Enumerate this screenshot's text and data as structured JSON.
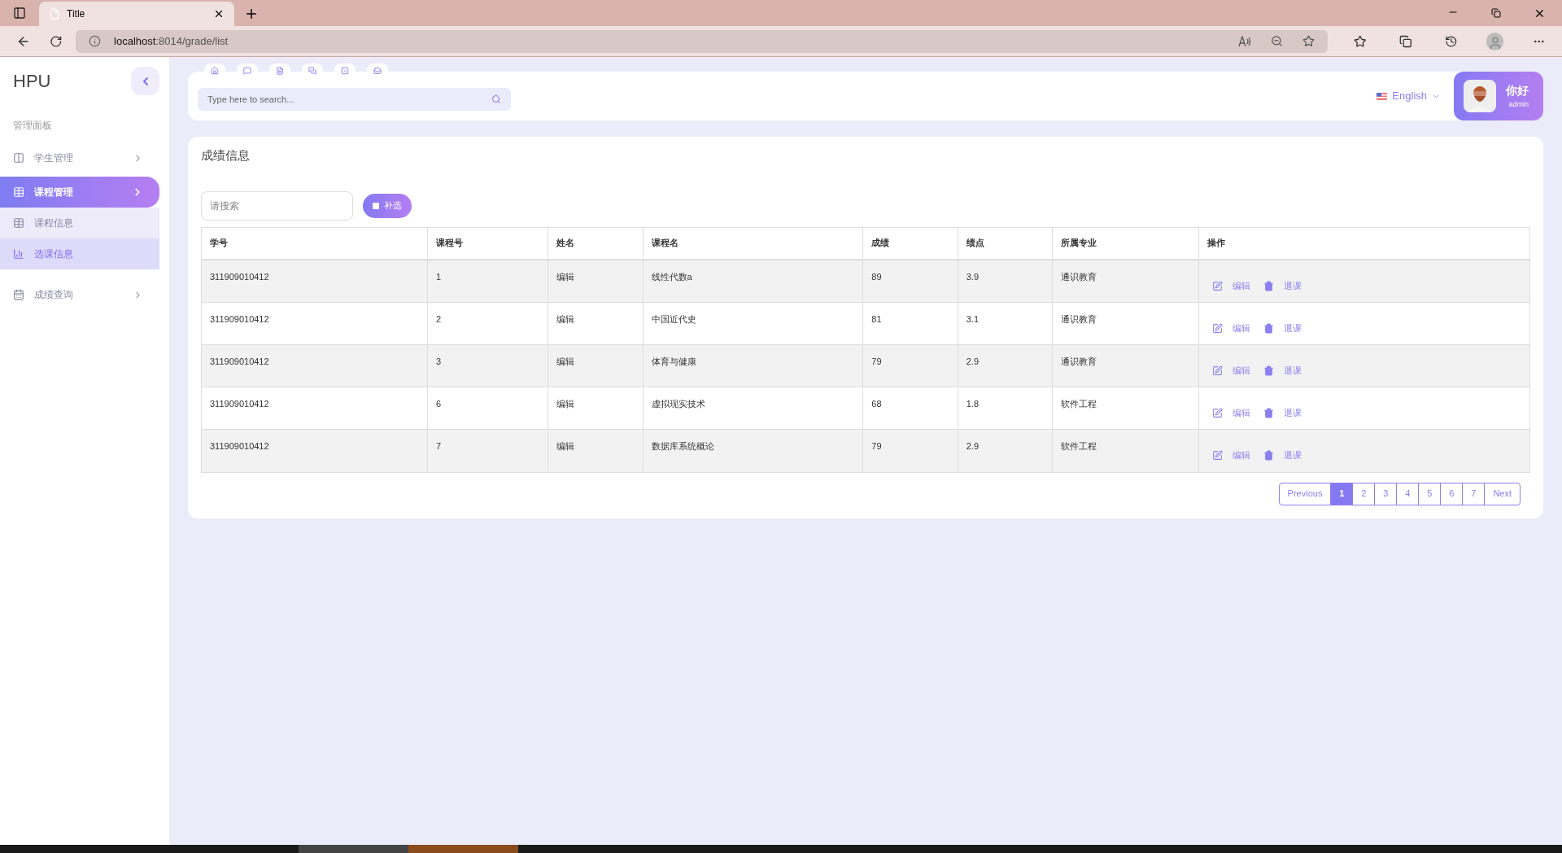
{
  "browser": {
    "tab_title": "Title",
    "url_host": "localhost",
    "url_path": ":8014/grade/list"
  },
  "sidebar": {
    "logo": "HPU",
    "section": "管理面板",
    "items": [
      {
        "label": "学生管理",
        "selected": false,
        "expanded": false
      },
      {
        "label": "课程管理",
        "selected": true,
        "expanded": true,
        "children": [
          {
            "label": "课程信息",
            "selected": false
          },
          {
            "label": "选课信息",
            "selected": true
          }
        ]
      },
      {
        "label": "成绩查询",
        "selected": false,
        "expanded": false
      }
    ]
  },
  "header": {
    "search": {
      "placeholder": "Type here to search..."
    },
    "language": "English",
    "user": {
      "greeting": "你好",
      "name": "admin"
    }
  },
  "panel": {
    "title": "成绩信息",
    "search": {
      "placeholder": "请搜索"
    },
    "add_button": "补选",
    "table": {
      "columns": [
        "学号",
        "课程号",
        "姓名",
        "课程名",
        "成绩",
        "绩点",
        "所属专业",
        "操作"
      ],
      "rows": [
        {
          "cells": [
            "311909010412",
            "1",
            "编辑",
            "线性代数a",
            "89",
            "3.9",
            "通识教育"
          ],
          "actions": [
            {
              "kind": "edit",
              "label": "编辑"
            },
            {
              "kind": "delete",
              "label": "退课"
            }
          ]
        },
        {
          "cells": [
            "311909010412",
            "2",
            "编辑",
            "中国近代史",
            "81",
            "3.1",
            "通识教育"
          ],
          "actions": [
            {
              "kind": "edit",
              "label": "编辑"
            },
            {
              "kind": "delete",
              "label": "退课"
            }
          ]
        },
        {
          "cells": [
            "311909010412",
            "3",
            "编辑",
            "体育与健康",
            "79",
            "2.9",
            "通识教育"
          ],
          "actions": [
            {
              "kind": "edit",
              "label": "编辑"
            },
            {
              "kind": "delete",
              "label": "退课"
            }
          ]
        },
        {
          "cells": [
            "311909010412",
            "6",
            "编辑",
            "虚拟现实技术",
            "68",
            "1.8",
            "软件工程"
          ],
          "actions": [
            {
              "kind": "edit",
              "label": "编辑"
            },
            {
              "kind": "delete",
              "label": "退课"
            }
          ]
        },
        {
          "cells": [
            "311909010412",
            "7",
            "编辑",
            "数据库系统概论",
            "79",
            "2.9",
            "软件工程"
          ],
          "actions": [
            {
              "kind": "edit",
              "label": "编辑"
            },
            {
              "kind": "delete",
              "label": "退课"
            }
          ]
        }
      ]
    },
    "pagination": {
      "previous": "Previous",
      "next": "Next",
      "pages": [
        {
          "label": "1",
          "selected": true
        },
        {
          "label": "2",
          "selected": false
        },
        {
          "label": "3",
          "selected": false
        },
        {
          "label": "4",
          "selected": false
        },
        {
          "label": "5",
          "selected": false
        },
        {
          "label": "6",
          "selected": false
        },
        {
          "label": "7",
          "selected": false
        }
      ]
    }
  }
}
